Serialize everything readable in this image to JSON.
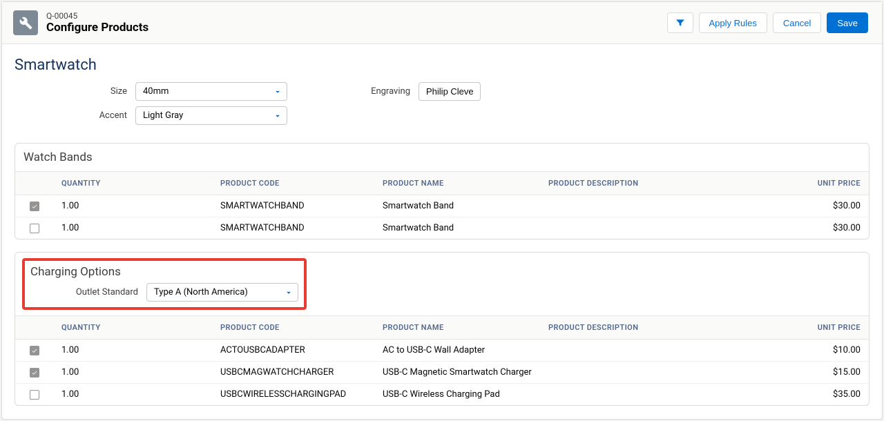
{
  "quote_num": "Q-00045",
  "page_title": "Configure Products",
  "buttons": {
    "apply_rules": "Apply Rules",
    "cancel": "Cancel",
    "save": "Save"
  },
  "product_title": "Smartwatch",
  "product_config": {
    "size_label": "Size",
    "size_value": "40mm",
    "accent_label": "Accent",
    "accent_value": "Light Gray",
    "engraving_label": "Engraving",
    "engraving_value": "Philip Cleve"
  },
  "columns": {
    "quantity": "QUANTITY",
    "product_code": "PRODUCT CODE",
    "product_name": "PRODUCT NAME",
    "product_description": "PRODUCT DESCRIPTION",
    "unit_price": "UNIT PRICE"
  },
  "sections": [
    {
      "title": "Watch Bands",
      "highlight": false,
      "controls": [],
      "rows": [
        {
          "checked": true,
          "quantity": "1.00",
          "code": "SMARTWATCHBAND",
          "name": "Smartwatch Band",
          "desc": "",
          "price": "$30.00"
        },
        {
          "checked": false,
          "quantity": "1.00",
          "code": "SMARTWATCHBAND",
          "name": "Smartwatch Band",
          "desc": "",
          "price": "$30.00"
        }
      ]
    },
    {
      "title": "Charging Options",
      "highlight": true,
      "controls": [
        {
          "label": "Outlet Standard",
          "value": "Type A (North America)"
        }
      ],
      "rows": [
        {
          "checked": true,
          "quantity": "1.00",
          "code": "ACTOUSBCADAPTER",
          "name": "AC to USB-C Wall Adapter",
          "desc": "",
          "price": "$10.00"
        },
        {
          "checked": true,
          "quantity": "1.00",
          "code": "USBCMAGWATCHCHARGER",
          "name": "USB-C Magnetic Smartwatch Charger",
          "desc": "",
          "price": "$15.00"
        },
        {
          "checked": false,
          "quantity": "1.00",
          "code": "USBCWIRELESSCHARGINGPAD",
          "name": "USB-C Wireless Charging Pad",
          "desc": "",
          "price": "$35.00"
        }
      ]
    }
  ]
}
